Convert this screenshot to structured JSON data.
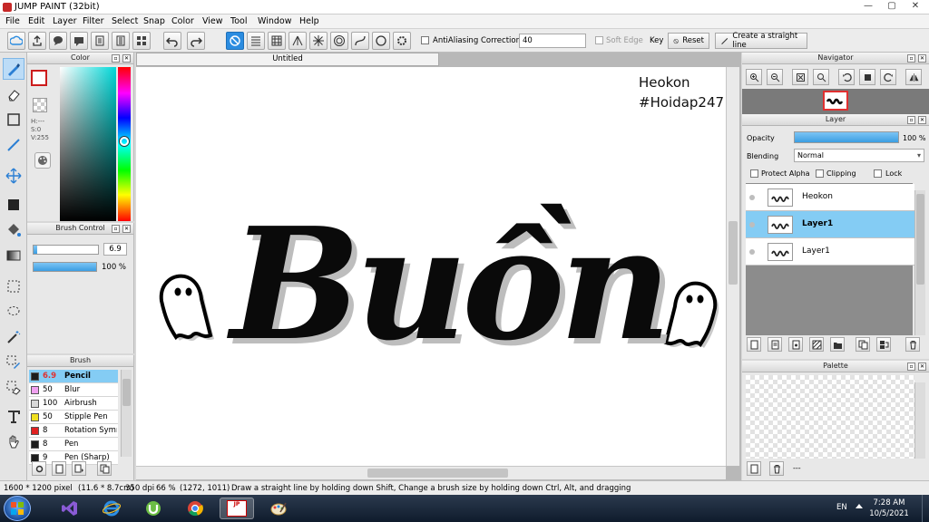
{
  "window": {
    "title": "JUMP PAINT (32bit)",
    "minimize": "—",
    "maximize": "▢",
    "close": "✕"
  },
  "menu": [
    "File",
    "Edit",
    "Layer",
    "Filter",
    "Select",
    "Snap",
    "Color",
    "View",
    "Tool",
    "Window",
    "Help"
  ],
  "toolbar": {
    "antialiasing": "AntiAliasing",
    "correction_label": "Correction",
    "correction_value": "40",
    "soft_edge": "Soft Edge",
    "key": "Key",
    "reset": "Reset",
    "straight_line": "Create a straight line"
  },
  "panels": {
    "color": "Color",
    "brush_control": "Brush Control",
    "brush": "Brush",
    "navigator": "Navigator",
    "layer": "Layer",
    "palette": "Palette"
  },
  "color_panel": {
    "h": "H:---",
    "s": "S:0",
    "v": "V:255",
    "primary": "#ffffff",
    "secondary": "#cc1c1c"
  },
  "brush_control": {
    "size": "6.9",
    "size_fraction": 0.06,
    "opacity": "100 %",
    "opacity_fraction": 1.0
  },
  "brushes": [
    {
      "size": "6.9",
      "name": "Pencil",
      "color": "#1c1c1c",
      "selected": true
    },
    {
      "size": "50",
      "name": "Blur",
      "color": "#f0a0f0",
      "selected": false
    },
    {
      "size": "100",
      "name": "Airbrush",
      "color": "#d8d8d8",
      "selected": false
    },
    {
      "size": "50",
      "name": "Stipple Pen",
      "color": "#f0e020",
      "selected": false
    },
    {
      "size": "8",
      "name": "Rotation Symm",
      "color": "#e02020",
      "selected": false
    },
    {
      "size": "8",
      "name": "Pen",
      "color": "#1c1c1c",
      "selected": false
    },
    {
      "size": "9",
      "name": "Pen (Sharp)",
      "color": "#1c1c1c",
      "selected": false
    }
  ],
  "document": {
    "tab": "Untitled",
    "note_line1": "Heokon",
    "note_line2": "#Hoidap247",
    "lettering": "Buồn"
  },
  "layer_panel": {
    "opacity_label": "Opacity",
    "opacity_value": "100 %",
    "blending_label": "Blending",
    "blending_value": "Normal",
    "protect_alpha": "Protect Alpha",
    "clipping": "Clipping",
    "lock": "Lock",
    "layers": [
      {
        "name": "Heokon",
        "selected": false
      },
      {
        "name": "Layer1",
        "selected": true
      },
      {
        "name": "Layer1",
        "selected": false
      }
    ]
  },
  "palette": {
    "count": "---"
  },
  "status": {
    "size": "1600 * 1200 pixel",
    "cm": "(11.6 * 8.7cm)",
    "dpi": "350 dpi",
    "zoom": "66 %",
    "coords": "(1272, 1011)",
    "hint": "Draw a straight line by holding down Shift, Change a brush size by holding down Ctrl, Alt, and dragging"
  },
  "taskbar": {
    "lang": "EN",
    "time": "7:28 AM",
    "date": "10/5/2021"
  }
}
